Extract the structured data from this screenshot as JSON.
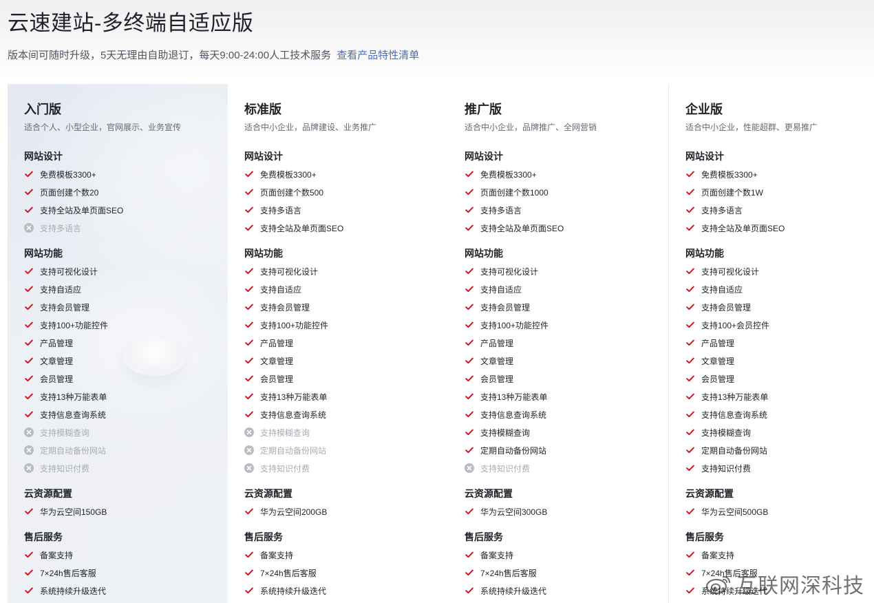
{
  "page": {
    "title": "云速建站-多终端自适应版",
    "subtitle": "版本间可随时升级，5天无理由自助退订，每天9:00-24:00人工技术服务",
    "subtitle_link": "查看产品特性清单"
  },
  "watermark": {
    "text": "互联网深科技",
    "icon": "weibo-logo-icon"
  },
  "colors": {
    "check": "#d0131f",
    "disabled": "#b9bdc3",
    "link": "#4e6fb3"
  },
  "plans": [
    {
      "name": "入门版",
      "desc": "适合个人、小型企业，官网展示、业务宣传",
      "sections": [
        {
          "title": "网站设计",
          "features": [
            {
              "label": "免费模板3300+",
              "enabled": true
            },
            {
              "label": "页面创建个数20",
              "enabled": true
            },
            {
              "label": "支持全站及单页面SEO",
              "enabled": true
            },
            {
              "label": "支持多语言",
              "enabled": false
            }
          ]
        },
        {
          "title": "网站功能",
          "features": [
            {
              "label": "支持可视化设计",
              "enabled": true
            },
            {
              "label": "支持自适应",
              "enabled": true
            },
            {
              "label": "支持会员管理",
              "enabled": true
            },
            {
              "label": "支持100+功能控件",
              "enabled": true
            },
            {
              "label": "产品管理",
              "enabled": true
            },
            {
              "label": "文章管理",
              "enabled": true
            },
            {
              "label": "会员管理",
              "enabled": true
            },
            {
              "label": "支持13种万能表单",
              "enabled": true
            },
            {
              "label": "支持信息查询系统",
              "enabled": true
            },
            {
              "label": "支持模糊查询",
              "enabled": false
            },
            {
              "label": "定期自动备份网站",
              "enabled": false
            },
            {
              "label": "支持知识付费",
              "enabled": false
            }
          ]
        },
        {
          "title": "云资源配置",
          "features": [
            {
              "label": "华为云空间150GB",
              "enabled": true
            }
          ]
        },
        {
          "title": "售后服务",
          "features": [
            {
              "label": "备案支持",
              "enabled": true
            },
            {
              "label": "7×24h售后客服",
              "enabled": true
            },
            {
              "label": "系统持续升级迭代",
              "enabled": true
            }
          ]
        }
      ]
    },
    {
      "name": "标准版",
      "desc": "适合中小企业，品牌建设、业务推广",
      "sections": [
        {
          "title": "网站设计",
          "features": [
            {
              "label": "免费模板3300+",
              "enabled": true
            },
            {
              "label": "页面创建个数500",
              "enabled": true
            },
            {
              "label": "支持多语言",
              "enabled": true
            },
            {
              "label": "支持全站及单页面SEO",
              "enabled": true
            }
          ]
        },
        {
          "title": "网站功能",
          "features": [
            {
              "label": "支持可视化设计",
              "enabled": true
            },
            {
              "label": "支持自适应",
              "enabled": true
            },
            {
              "label": "支持会员管理",
              "enabled": true
            },
            {
              "label": "支持100+功能控件",
              "enabled": true
            },
            {
              "label": "产品管理",
              "enabled": true
            },
            {
              "label": "文章管理",
              "enabled": true
            },
            {
              "label": "会员管理",
              "enabled": true
            },
            {
              "label": "支持13种万能表单",
              "enabled": true
            },
            {
              "label": "支持信息查询系统",
              "enabled": true
            },
            {
              "label": "支持模糊查询",
              "enabled": false
            },
            {
              "label": "定期自动备份网站",
              "enabled": false
            },
            {
              "label": "支持知识付费",
              "enabled": false
            }
          ]
        },
        {
          "title": "云资源配置",
          "features": [
            {
              "label": "华为云空间200GB",
              "enabled": true
            }
          ]
        },
        {
          "title": "售后服务",
          "features": [
            {
              "label": "备案支持",
              "enabled": true
            },
            {
              "label": "7×24h售后客服",
              "enabled": true
            },
            {
              "label": "系统持续升级迭代",
              "enabled": true
            }
          ]
        }
      ]
    },
    {
      "name": "推广版",
      "desc": "适合中小企业，品牌推广、全网营销",
      "sections": [
        {
          "title": "网站设计",
          "features": [
            {
              "label": "免费模板3300+",
              "enabled": true
            },
            {
              "label": "页面创建个数1000",
              "enabled": true
            },
            {
              "label": "支持多语言",
              "enabled": true
            },
            {
              "label": "支持全站及单页面SEO",
              "enabled": true
            }
          ]
        },
        {
          "title": "网站功能",
          "features": [
            {
              "label": "支持可视化设计",
              "enabled": true
            },
            {
              "label": "支持自适应",
              "enabled": true
            },
            {
              "label": "支持会员管理",
              "enabled": true
            },
            {
              "label": "支持100+功能控件",
              "enabled": true
            },
            {
              "label": "产品管理",
              "enabled": true
            },
            {
              "label": "文章管理",
              "enabled": true
            },
            {
              "label": "会员管理",
              "enabled": true
            },
            {
              "label": "支持13种万能表单",
              "enabled": true
            },
            {
              "label": "支持信息查询系统",
              "enabled": true
            },
            {
              "label": "支持模糊查询",
              "enabled": true
            },
            {
              "label": "定期自动备份网站",
              "enabled": true
            },
            {
              "label": "支持知识付费",
              "enabled": false
            }
          ]
        },
        {
          "title": "云资源配置",
          "features": [
            {
              "label": "华为云空间300GB",
              "enabled": true
            }
          ]
        },
        {
          "title": "售后服务",
          "features": [
            {
              "label": "备案支持",
              "enabled": true
            },
            {
              "label": "7×24h售后客服",
              "enabled": true
            },
            {
              "label": "系统持续升级迭代",
              "enabled": true
            }
          ]
        }
      ]
    },
    {
      "name": "企业版",
      "desc": "适合中小企业，性能超群、更易推广",
      "sections": [
        {
          "title": "网站设计",
          "features": [
            {
              "label": "免费模板3300+",
              "enabled": true
            },
            {
              "label": "页面创建个数1W",
              "enabled": true
            },
            {
              "label": "支持多语言",
              "enabled": true
            },
            {
              "label": "支持全站及单页面SEO",
              "enabled": true
            }
          ]
        },
        {
          "title": "网站功能",
          "features": [
            {
              "label": "支持可视化设计",
              "enabled": true
            },
            {
              "label": "支持自适应",
              "enabled": true
            },
            {
              "label": "支持会员管理",
              "enabled": true
            },
            {
              "label": "支持100+会员控件",
              "enabled": true
            },
            {
              "label": "产品管理",
              "enabled": true
            },
            {
              "label": "文章管理",
              "enabled": true
            },
            {
              "label": "会员管理",
              "enabled": true
            },
            {
              "label": "支持13种万能表单",
              "enabled": true
            },
            {
              "label": "支持信息查询系统",
              "enabled": true
            },
            {
              "label": "支持模糊查询",
              "enabled": true
            },
            {
              "label": "定期自动备份网站",
              "enabled": true
            },
            {
              "label": "支持知识付费",
              "enabled": true
            }
          ]
        },
        {
          "title": "云资源配置",
          "features": [
            {
              "label": "华为云空间500GB",
              "enabled": true
            }
          ]
        },
        {
          "title": "售后服务",
          "features": [
            {
              "label": "备案支持",
              "enabled": true
            },
            {
              "label": "7×24h售后客服",
              "enabled": true
            },
            {
              "label": "系统持续升级迭代",
              "enabled": true
            }
          ]
        }
      ]
    }
  ]
}
